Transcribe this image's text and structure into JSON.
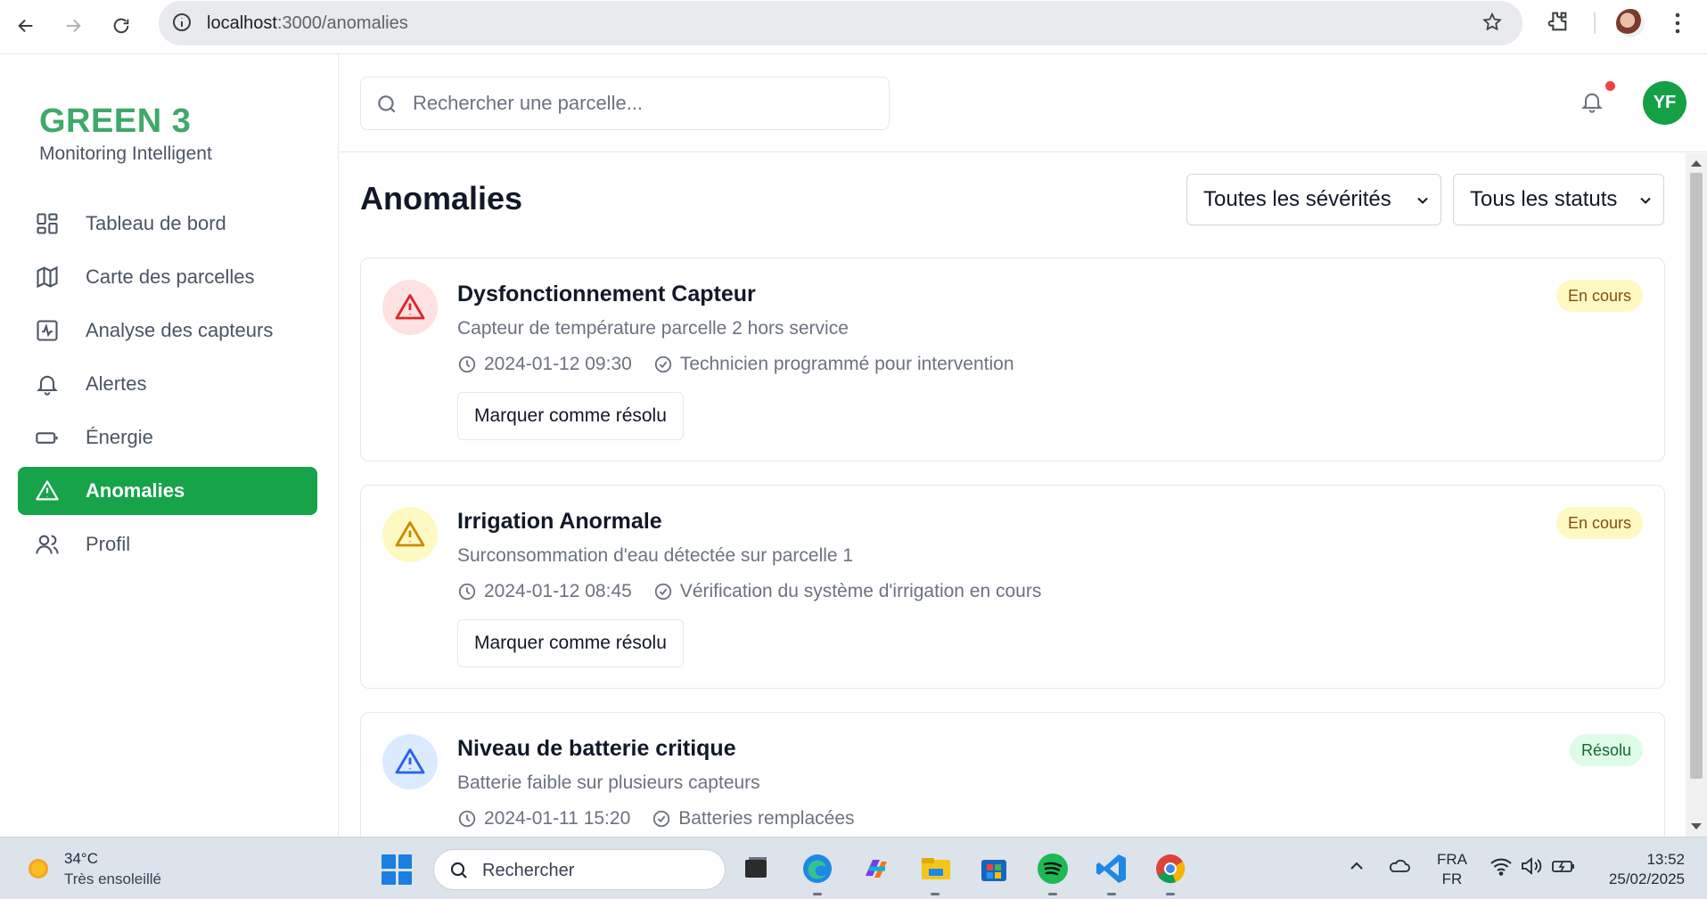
{
  "browser": {
    "url_host": "localhost",
    "url_path": ":3000/anomalies"
  },
  "sidebar": {
    "brand": "GREEN 3",
    "tagline": "Monitoring Intelligent",
    "items": [
      {
        "label": "Tableau de bord",
        "icon": "dashboard-icon"
      },
      {
        "label": "Carte des parcelles",
        "icon": "map-icon"
      },
      {
        "label": "Analyse des capteurs",
        "icon": "activity-icon"
      },
      {
        "label": "Alertes",
        "icon": "bell-icon"
      },
      {
        "label": "Énergie",
        "icon": "battery-icon"
      },
      {
        "label": "Anomalies",
        "icon": "warning-icon",
        "active": true
      },
      {
        "label": "Profil",
        "icon": "users-icon"
      }
    ]
  },
  "topbar": {
    "search_placeholder": "Rechercher une parcelle...",
    "avatar_initials": "YF"
  },
  "main": {
    "title": "Anomalies",
    "severity_filter": "Toutes les sévérités",
    "status_filter": "Tous les statuts"
  },
  "anomalies": [
    {
      "title": "Dysfonctionnement Capteur",
      "description": "Capteur de température parcelle 2 hors service",
      "timestamp": "2024-01-12 09:30",
      "action": "Technicien programmé pour intervention",
      "status": "En cours",
      "resolve_label": "Marquer comme résolu",
      "severity_color": "#dc2626",
      "severity_bg": "#fee2e2"
    },
    {
      "title": "Irrigation Anormale",
      "description": "Surconsommation d'eau détectée sur parcelle 1",
      "timestamp": "2024-01-12 08:45",
      "action": "Vérification du système d'irrigation en cours",
      "status": "En cours",
      "resolve_label": "Marquer comme résolu",
      "severity_color": "#ca8a04",
      "severity_bg": "#fef9c3"
    },
    {
      "title": "Niveau de batterie critique",
      "description": "Batterie faible sur plusieurs capteurs",
      "timestamp": "2024-01-11 15:20",
      "action": "Batteries remplacées",
      "status": "Résolu",
      "resolve_label": "",
      "severity_color": "#2563eb",
      "severity_bg": "#dbeafe"
    }
  ],
  "taskbar": {
    "temperature": "34°C",
    "weather": "Très ensoleillé",
    "search_label": "Rechercher",
    "lang_top": "FRA",
    "lang_bottom": "FR",
    "time": "13:52",
    "date": "25/02/2025"
  }
}
